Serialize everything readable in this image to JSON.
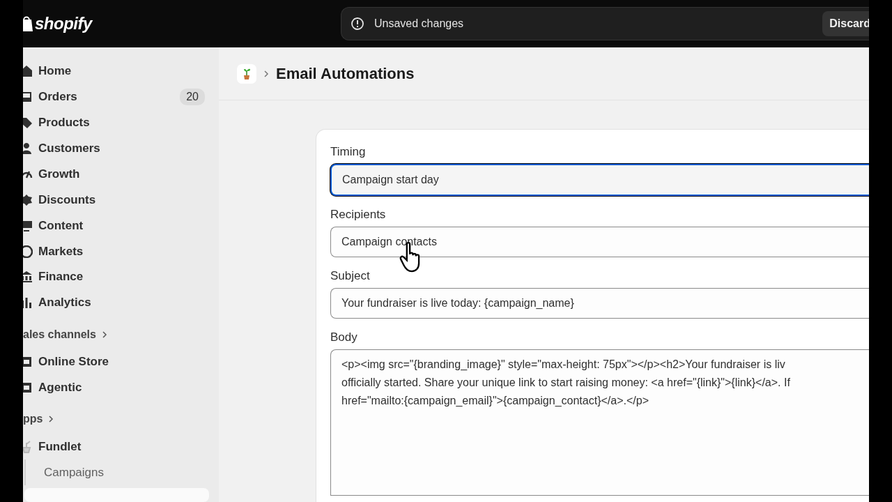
{
  "topbar": {
    "logo": "shopify",
    "notice": "Unsaved changes",
    "discard_button": "Discard"
  },
  "sidebar": {
    "items": [
      {
        "label": "Home",
        "kind": "nav",
        "selected": false
      },
      {
        "label": "Orders",
        "kind": "nav",
        "badge": "20",
        "selected": false
      },
      {
        "label": "Products",
        "kind": "nav",
        "selected": false
      },
      {
        "label": "Customers",
        "kind": "nav",
        "selected": false
      },
      {
        "label": "Growth",
        "kind": "nav",
        "selected": false
      },
      {
        "label": "Discounts",
        "kind": "nav",
        "selected": false
      },
      {
        "label": "Content",
        "kind": "nav",
        "selected": false
      },
      {
        "label": "Markets",
        "kind": "nav",
        "selected": false
      },
      {
        "label": "Finance",
        "kind": "nav",
        "selected": false
      },
      {
        "label": "Analytics",
        "kind": "nav",
        "selected": false
      },
      {
        "label": "ales channels",
        "kind": "section"
      },
      {
        "label": "Online Store",
        "kind": "nav",
        "selected": false
      },
      {
        "label": "Agentic",
        "kind": "nav",
        "selected": false
      },
      {
        "label": "pps",
        "kind": "section"
      },
      {
        "label": "Fundlet",
        "kind": "nav",
        "selected": false
      },
      {
        "label": "Campaigns",
        "kind": "sub",
        "selected": false
      },
      {
        "kind": "sub-hidden",
        "selected": true
      }
    ]
  },
  "header": {
    "title": "Email Automations"
  },
  "form": {
    "fields": [
      {
        "label": "Timing",
        "value": "Campaign start day",
        "kind": "select",
        "focused": true
      },
      {
        "label": "Recipients",
        "value": "Campaign contacts",
        "kind": "select",
        "focused": false
      },
      {
        "label": "Subject",
        "value": "Your fundraiser is live today: {campaign_name}",
        "kind": "text",
        "focused": false
      },
      {
        "label": "Body",
        "kind": "textarea",
        "focused": false,
        "lines": [
          "<p><img src=\"{branding_image}\" style=\"max-height: 75px\"></p><h2>Your fundraiser is liv",
          "officially started. Share your unique link to start raising money: <a href=\"{link}\">{link}</a>. If",
          "href=\"mailto:{campaign_email}\">{campaign_contact}</a>.</p>"
        ]
      }
    ]
  }
}
